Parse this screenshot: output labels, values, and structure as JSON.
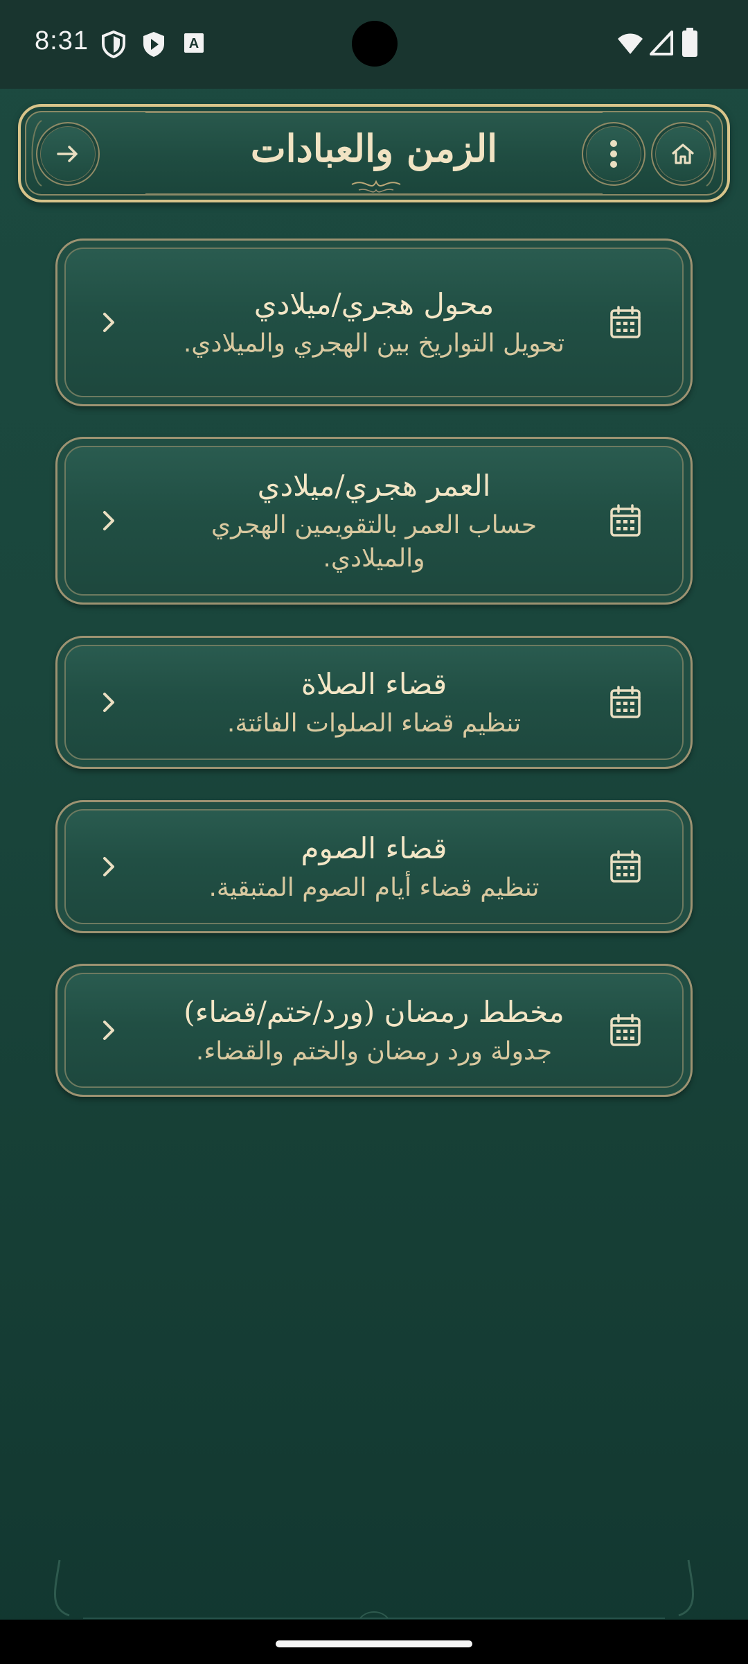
{
  "status_bar": {
    "time": "8:31"
  },
  "header": {
    "title": "الزمن والعبادات",
    "back_icon": "arrow-right-icon",
    "menu_icon": "more-vert-icon",
    "home_icon": "home-icon"
  },
  "colors": {
    "background": "#1a463c",
    "gold_border": "#d8c48a",
    "title_text": "#f1e3c3",
    "desc_text": "#d9c9a0"
  },
  "cards": [
    {
      "title": "محول هجري/ميلادي",
      "description": "تحويل التواريخ بين الهجري والميلادي.",
      "icon": "calendar-icon"
    },
    {
      "title": "العمر هجري/ميلادي",
      "description": "حساب العمر بالتقويمين الهجري والميلادي.",
      "icon": "calendar-icon"
    },
    {
      "title": "قضاء الصلاة",
      "description": "تنظيم قضاء الصلوات الفائتة.",
      "icon": "calendar-icon"
    },
    {
      "title": "قضاء الصوم",
      "description": "تنظيم قضاء أيام الصوم المتبقية.",
      "icon": "calendar-icon"
    },
    {
      "title": "مخطط رمضان (ورد/ختم/قضاء)",
      "description": "جدولة ورد رمضان والختم والقضاء.",
      "icon": "calendar-icon"
    }
  ]
}
